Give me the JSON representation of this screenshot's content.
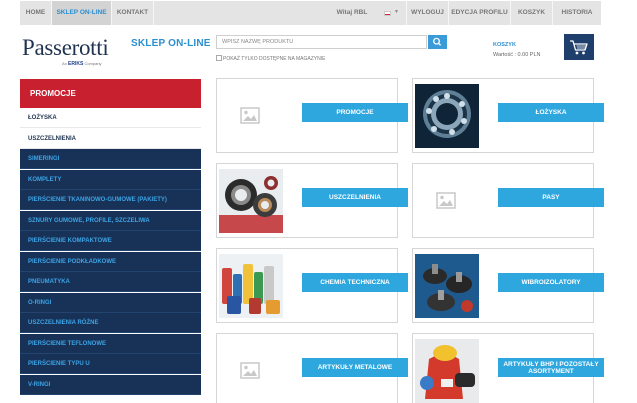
{
  "nav": {
    "home": "HOME",
    "shop": "SKLEP ON-LINE",
    "contact": "KONTAKT",
    "greeting": "Witaj RBL",
    "logout": "WYLOGUJ",
    "profile": "EDYCJA PROFILU",
    "cart": "KOSZYK",
    "history": "HISTORIA"
  },
  "header": {
    "logo": "Passerotti",
    "logo_prefix": "An",
    "logo_brand": "ERIKS",
    "logo_suffix": "Company",
    "shop_title": "SKLEP ON-LINE",
    "search_placeholder": "WPISZ NAZWĘ PRODUKTU",
    "available_only": "POKAŻ TYLKO DOSTĘPNE NA MAGAZYNIE",
    "cart_label": "KOSZYK",
    "cart_value": "Wartość : 0.00 PLN"
  },
  "sidebar": {
    "promo": "PROMOCJE",
    "items": [
      "ŁOŻYSKA",
      "USZCZELNIENIA",
      "SIMERINGI",
      "KOMPLETY",
      "PIERŚCIENIE TKANINOWO-GUMOWE (PAKIETY)",
      "SZNURY GUMOWE, PROFILE, SZCZELIWA",
      "PIERŚCIENIE KOMPAKTOWE",
      "PIERŚCIENIE PODKŁADKOWE",
      "PNEUMATYKA",
      "O-RINGI",
      "USZCZELNIENIA RÓŻNE",
      "PIERŚCIENIE TEFLONOWE",
      "PIERŚCIENIE TYPU U",
      "V-RINGI"
    ]
  },
  "tiles": [
    "PROMOCJE",
    "ŁOŻYSKA",
    "USZCZELNIENIA",
    "PASY",
    "CHEMIA TECHNICZNA",
    "WIBROIZOLATORY",
    "ARTYKUŁY METALOWE",
    "ARTYKUŁY BHP I POZOSTAŁY ASORTYMENT"
  ],
  "colors": {
    "accent": "#2ea7df",
    "promo_red": "#c8202f",
    "sidebar_dark": "#173256",
    "nav_bg": "#e4e4e4"
  }
}
